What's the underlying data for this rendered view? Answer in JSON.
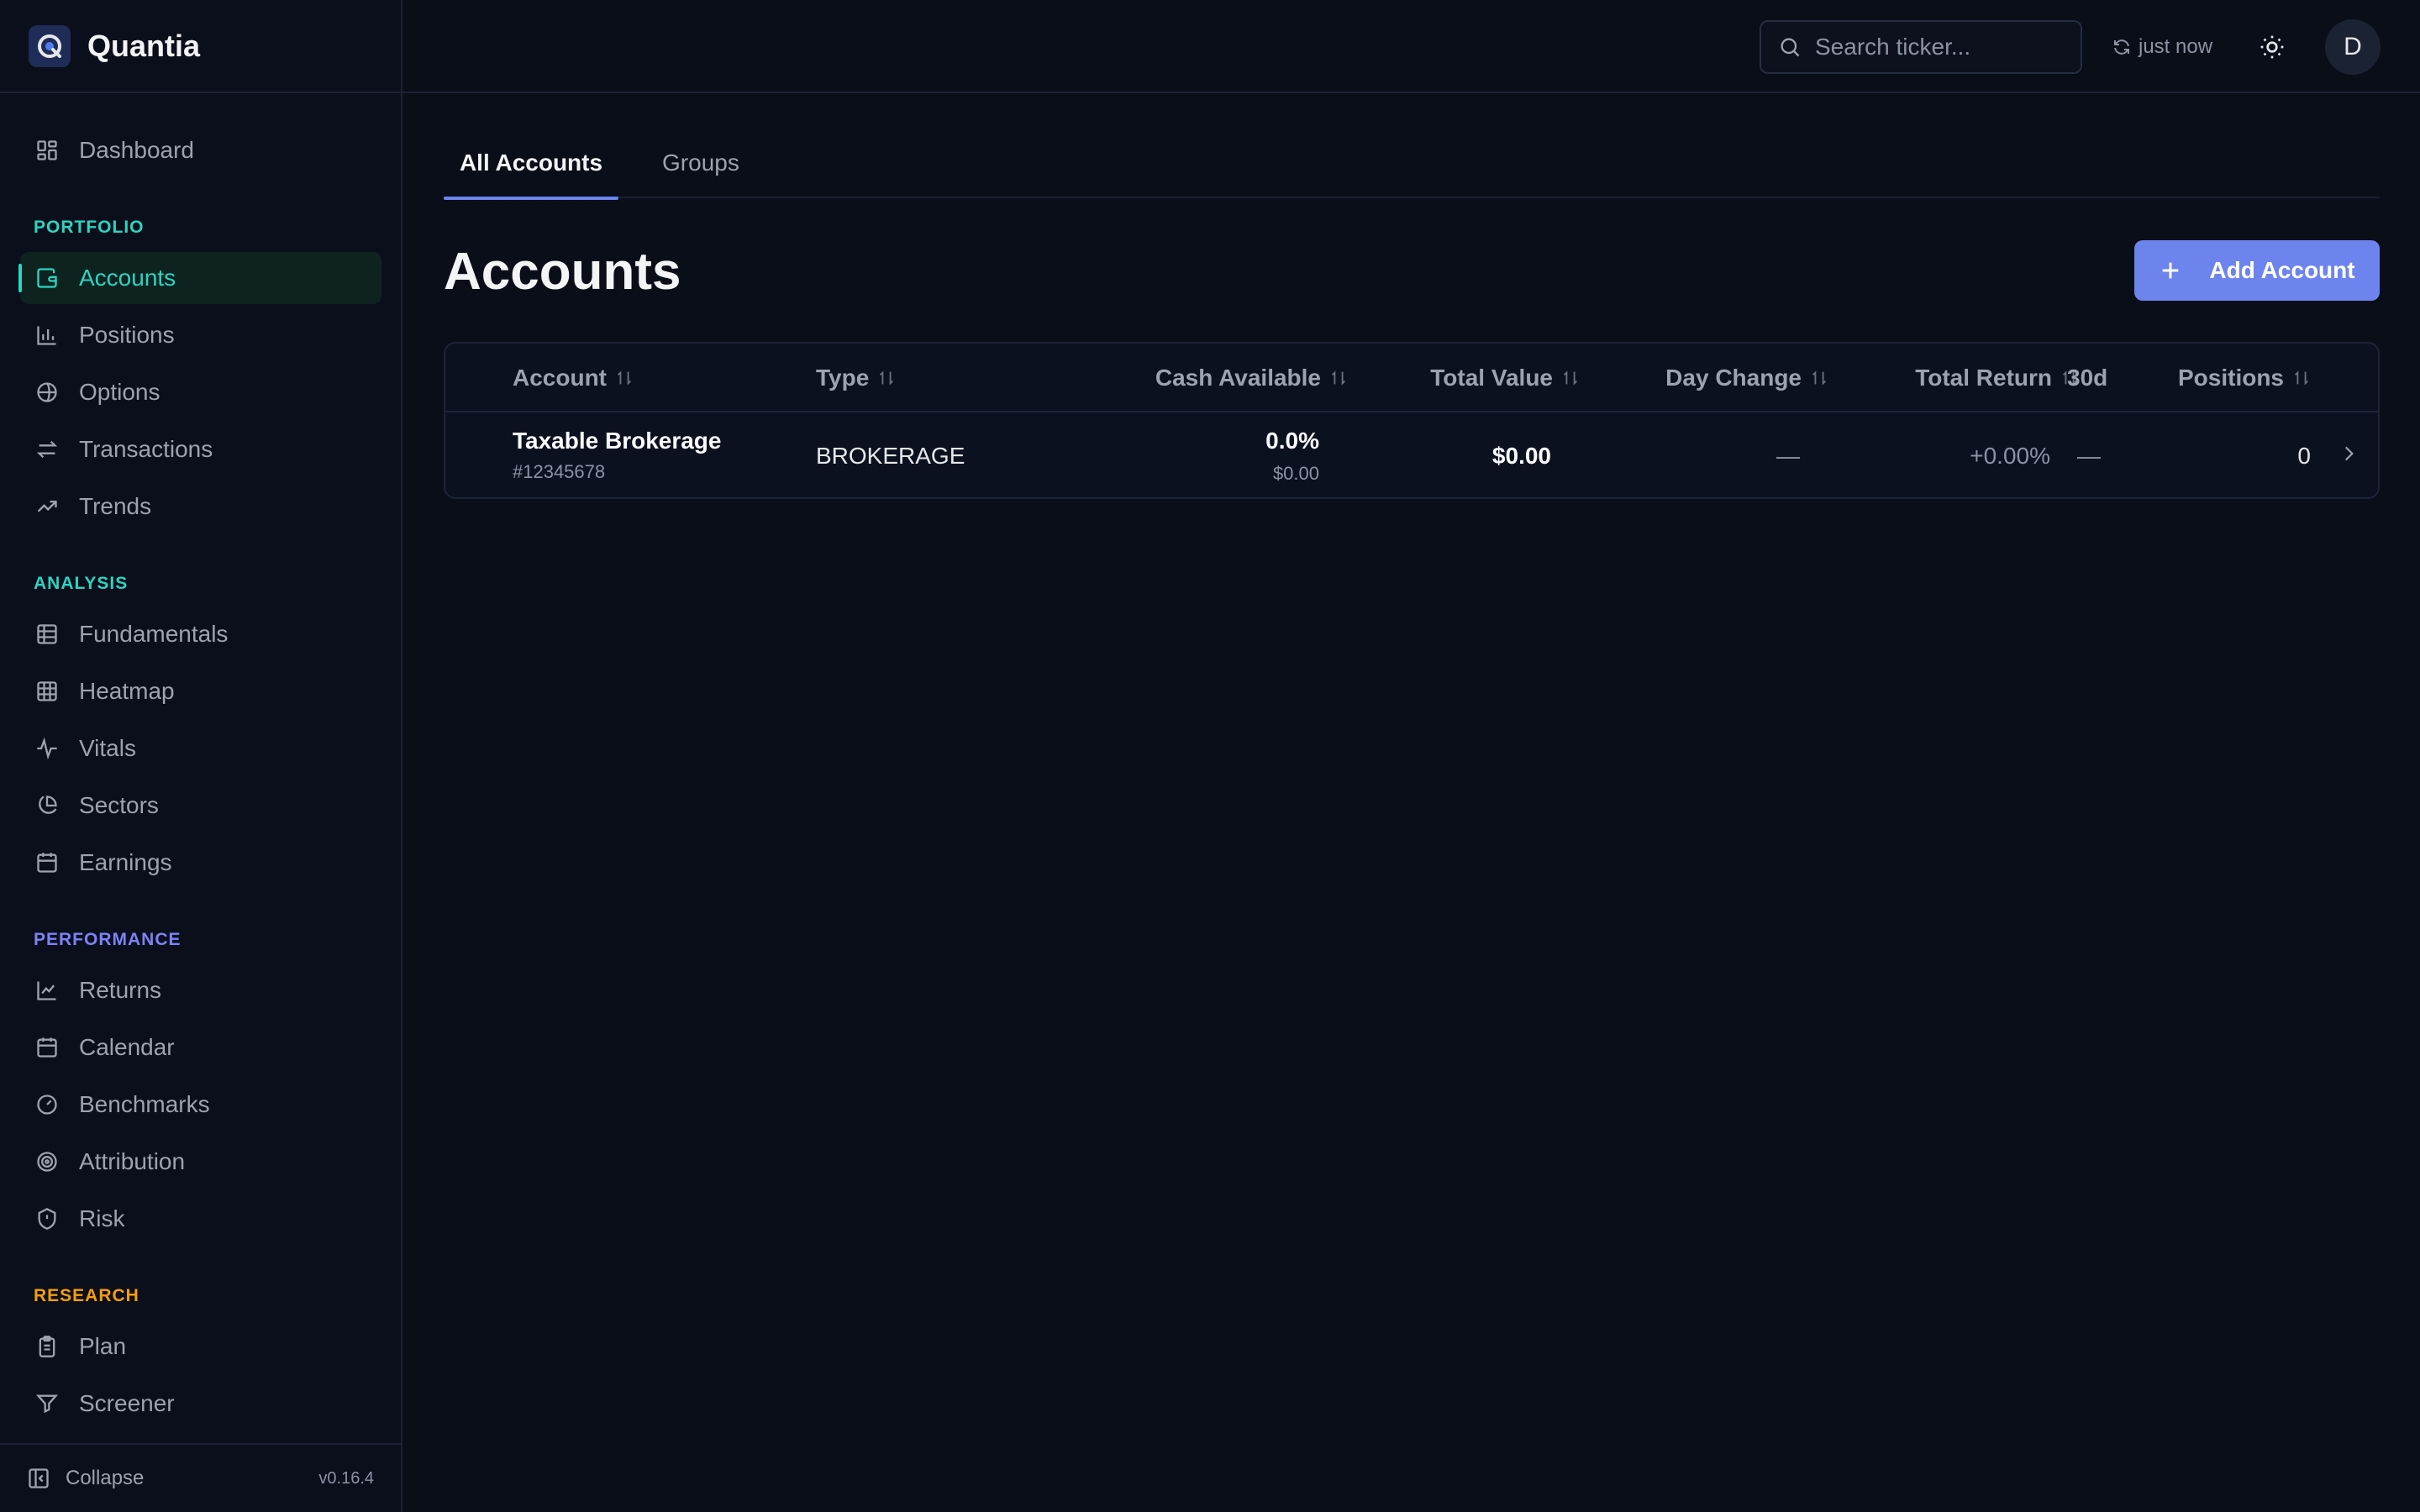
{
  "brand": {
    "name": "Quantia"
  },
  "sidebar": {
    "dashboard": "Dashboard",
    "sections": {
      "portfolio": {
        "label": "PORTFOLIO",
        "color": "#2dd4bf"
      },
      "analysis": {
        "label": "ANALYSIS",
        "color": "#2dd4bf"
      },
      "performance": {
        "label": "PERFORMANCE",
        "color": "#7c83f5"
      },
      "research": {
        "label": "RESEARCH",
        "color": "#f59e0b"
      }
    },
    "items": {
      "accounts": "Accounts",
      "positions": "Positions",
      "options": "Options",
      "transactions": "Transactions",
      "trends": "Trends",
      "fundamentals": "Fundamentals",
      "heatmap": "Heatmap",
      "vitals": "Vitals",
      "sectors": "Sectors",
      "earnings": "Earnings",
      "returns": "Returns",
      "calendar": "Calendar",
      "benchmarks": "Benchmarks",
      "attribution": "Attribution",
      "risk": "Risk",
      "plan": "Plan",
      "screener": "Screener"
    },
    "footer": {
      "collapse": "Collapse",
      "version": "v0.16.4"
    }
  },
  "header": {
    "search_placeholder": "Search ticker...",
    "refresh_status": "just now",
    "avatar_initial": "D"
  },
  "tabs": {
    "all_accounts": "All Accounts",
    "groups": "Groups"
  },
  "page": {
    "title": "Accounts",
    "add_button": "Add Account"
  },
  "table": {
    "columns": {
      "account": "Account",
      "type": "Type",
      "cash": "Cash Available",
      "total_value": "Total Value",
      "day_change": "Day Change",
      "total_return": "Total Return",
      "d30": "30d",
      "positions": "Positions"
    },
    "rows": [
      {
        "name": "Taxable Brokerage",
        "number": "#12345678",
        "type": "BROKERAGE",
        "cash_pct": "0.0%",
        "cash_amount": "$0.00",
        "total_value": "$0.00",
        "day_change": "—",
        "total_return": "+0.00%",
        "d30": "—",
        "positions": "0"
      }
    ]
  },
  "colors": {
    "accent": "#6d84ee",
    "active_nav": "#2dd4bf",
    "background": "#0a0e19"
  }
}
